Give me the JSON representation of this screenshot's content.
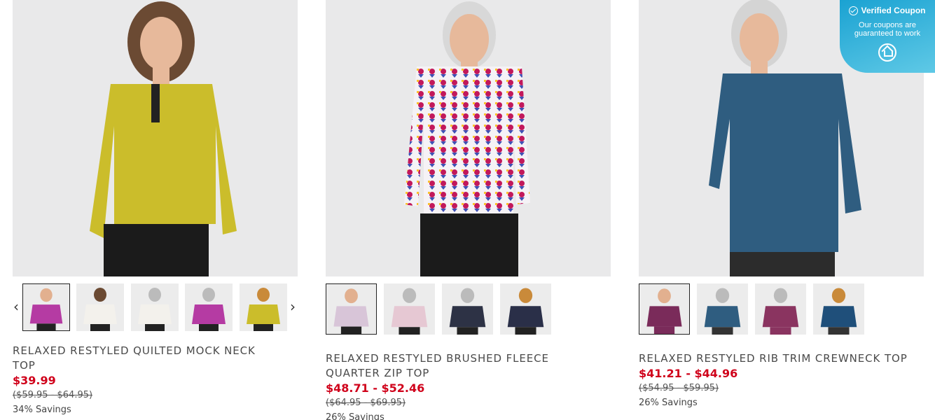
{
  "coupon": {
    "title": "Verified Coupon",
    "subtitle_line1": "Our coupons are",
    "subtitle_line2": "guaranteed to work"
  },
  "products": [
    {
      "title_line1": "RELAXED RESTYLED QUILTED MOCK NECK",
      "title_line2": "TOP",
      "price": "$39.99",
      "original_price": "($59.95 - $64.95)",
      "savings": "34% Savings",
      "main_color": "#cbbd2b",
      "thumbs": [
        "#b53ba3",
        "#f3f1ec",
        "#f3f1ec",
        "#b53ba3",
        "#cbbd2b"
      ],
      "prev_icon": "chevron-left-icon",
      "next_icon": "chevron-right-icon"
    },
    {
      "title_line1": "RELAXED RESTYLED BRUSHED FLEECE",
      "title_line2": "QUARTER ZIP TOP",
      "price": "$48.71 - $52.46",
      "original_price": "($64.95 - $69.95)",
      "savings": "26% Savings",
      "main_color": "#ede7ef",
      "thumbs": [
        "#d8c5d8",
        "#e6c8d3",
        "#2d3245",
        "#2a2f48"
      ]
    },
    {
      "title_line1": "RELAXED RESTYLED RIB TRIM CREWNECK TOP",
      "title_line2": "",
      "price": "$41.21 - $44.96",
      "original_price": "($54.95 - $59.95)",
      "savings": "26% Savings",
      "main_color": "#2f5d80",
      "thumbs": [
        "#7a2b5a",
        "#2f5d80",
        "#8a3460",
        "#1f4f7a"
      ]
    }
  ]
}
